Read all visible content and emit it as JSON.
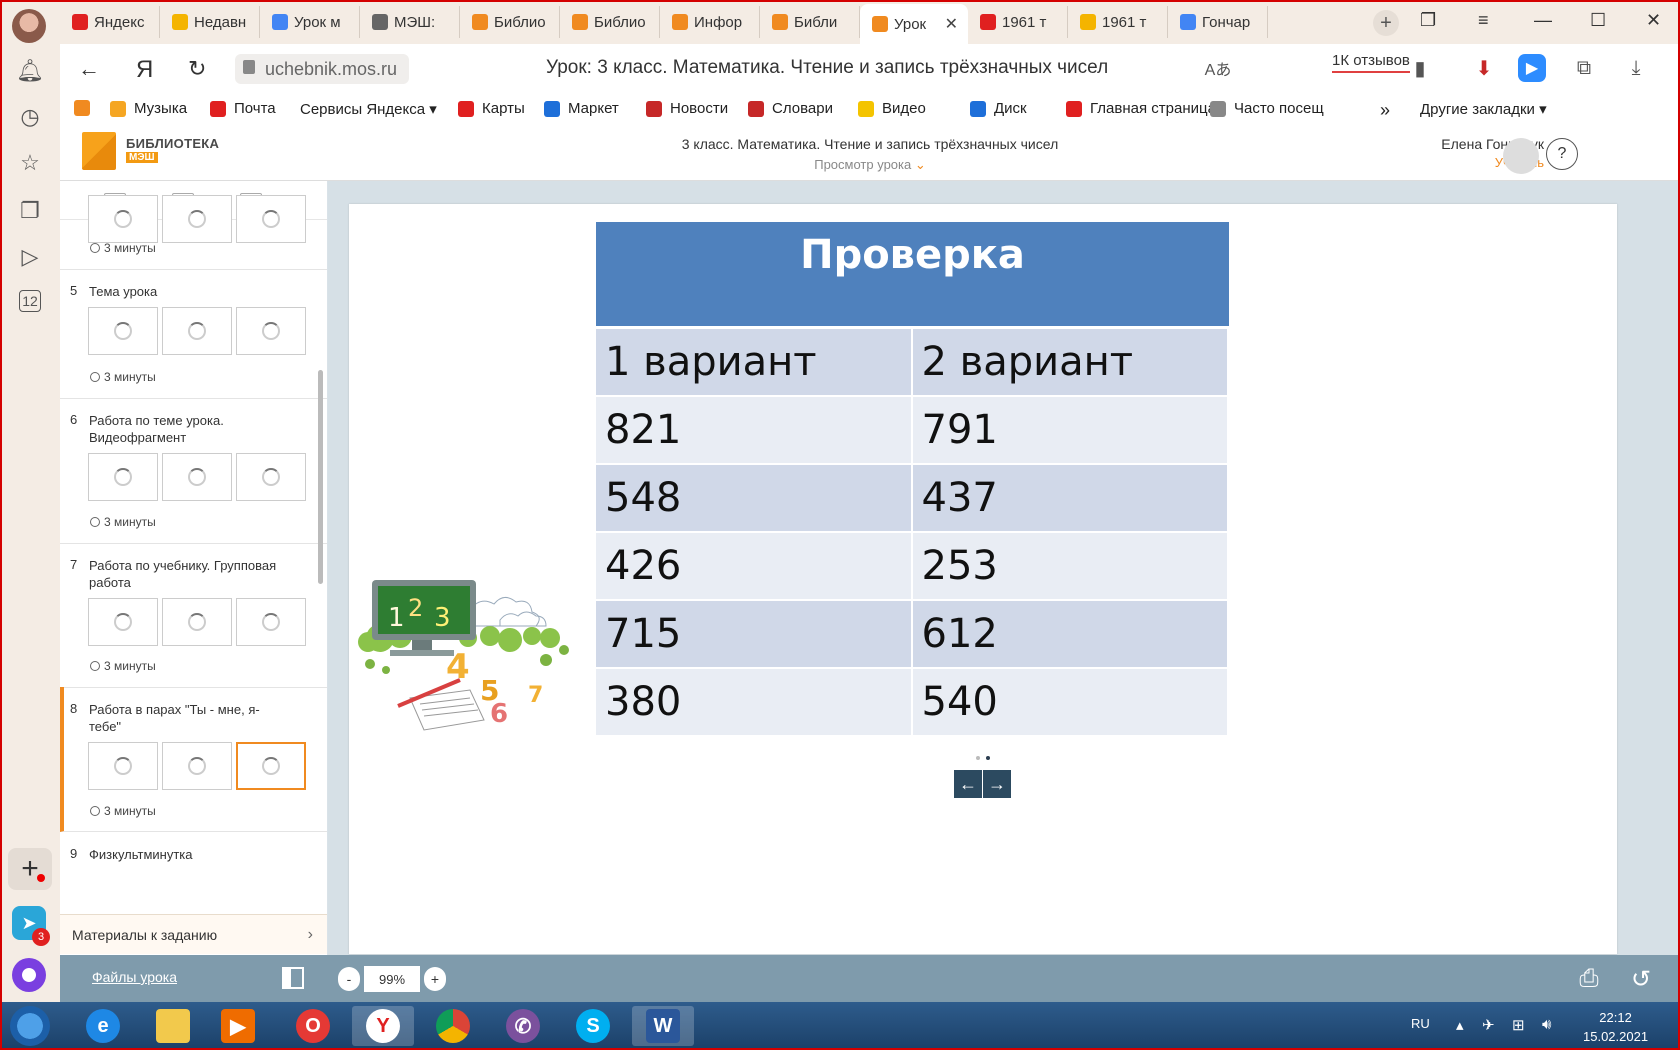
{
  "browser": {
    "tabs": [
      {
        "label": "Яндекс",
        "favicon": "yandex-icon",
        "color": "#e02020"
      },
      {
        "label": "Недавн",
        "favicon": "google-drive-icon",
        "color": "#f4b400"
      },
      {
        "label": "Урок м",
        "favicon": "docs-icon",
        "color": "#4285f4"
      },
      {
        "label": "МЭШ:",
        "favicon": "form-icon",
        "color": "#666666"
      },
      {
        "label": "Библио",
        "favicon": "library-icon",
        "color": "#f08a20"
      },
      {
        "label": "Библио",
        "favicon": "library-icon",
        "color": "#f08a20"
      },
      {
        "label": "Инфор",
        "favicon": "library-icon",
        "color": "#f08a20"
      },
      {
        "label": "Библи",
        "favicon": "library-icon",
        "color": "#f08a20"
      },
      {
        "label": "Урок",
        "favicon": "library-icon",
        "color": "#f08a20",
        "active": true
      },
      {
        "label": "1961 т",
        "favicon": "yandex-icon",
        "color": "#e02020"
      },
      {
        "label": "1961 т",
        "favicon": "images-icon",
        "color": "#f4b400"
      },
      {
        "label": "Гончар",
        "favicon": "doc-icon",
        "color": "#4285f4"
      }
    ],
    "url": "uchebnik.mos.ru",
    "page_title": "Урок: 3 класс. Математика. Чтение и запись трёхзначных чисел",
    "reviews": "1К отзывов",
    "bookmarks": [
      {
        "label": "",
        "color": "#f08a20"
      },
      {
        "label": "Музыка",
        "color": "#f5a623"
      },
      {
        "label": "Почта",
        "color": "#e02020"
      },
      {
        "label": "Сервисы Яндекса ▾",
        "color": ""
      },
      {
        "label": "Карты",
        "color": "#e02020"
      },
      {
        "label": "Маркет",
        "color": "#1e6fd9"
      },
      {
        "label": "Новости",
        "color": "#c62828"
      },
      {
        "label": "Словари",
        "color": "#c62828"
      },
      {
        "label": "Видео",
        "color": "#f4c400"
      },
      {
        "label": "Диск",
        "color": "#1e6fd9"
      },
      {
        "label": "Главная страница",
        "color": "#e02020"
      },
      {
        "label": "Часто посещ",
        "color": "#888888"
      },
      {
        "label": "Другие закладки ▾",
        "color": ""
      }
    ]
  },
  "site": {
    "logo_title": "БИБЛИОТЕКА",
    "logo_sub": "МЭШ",
    "title": "3 класс. Математика. Чтение и запись трёхзначных чисел",
    "subtitle": "Просмотр урока",
    "user_name": "Елена Гончарук",
    "user_role": "Учитель",
    "help": "?"
  },
  "sidebar": {
    "steps": [
      {
        "num": "",
        "title": "",
        "duration": "3 минуты"
      },
      {
        "num": "5",
        "title": "Тема урока",
        "duration": "3 минуты"
      },
      {
        "num": "6",
        "title": "Работа по теме урока. Видеофрагмент",
        "duration": "3 минуты"
      },
      {
        "num": "7",
        "title": "Работа по учебнику. Групповая работа",
        "duration": "3 минуты"
      },
      {
        "num": "8",
        "title": "Работа в парах \"Ты - мне, я- тебе\"",
        "duration": "3 минуты"
      },
      {
        "num": "9",
        "title": "Физкультминутка",
        "duration": ""
      }
    ],
    "materials": "Материалы к заданию"
  },
  "slide": {
    "header": "Проверка",
    "col1": "1 вариант",
    "col2": "2 вариант",
    "rows": [
      [
        "821",
        "791"
      ],
      [
        "548",
        "437"
      ],
      [
        "426",
        "253"
      ],
      [
        "715",
        "612"
      ],
      [
        "380",
        "540"
      ]
    ]
  },
  "bottom": {
    "files": "Файлы урока",
    "zoom_minus": "-",
    "zoom": "99%",
    "zoom_plus": "+"
  },
  "taskbar": {
    "lang": "RU",
    "time": "22:12",
    "date": "15.02.2021"
  }
}
